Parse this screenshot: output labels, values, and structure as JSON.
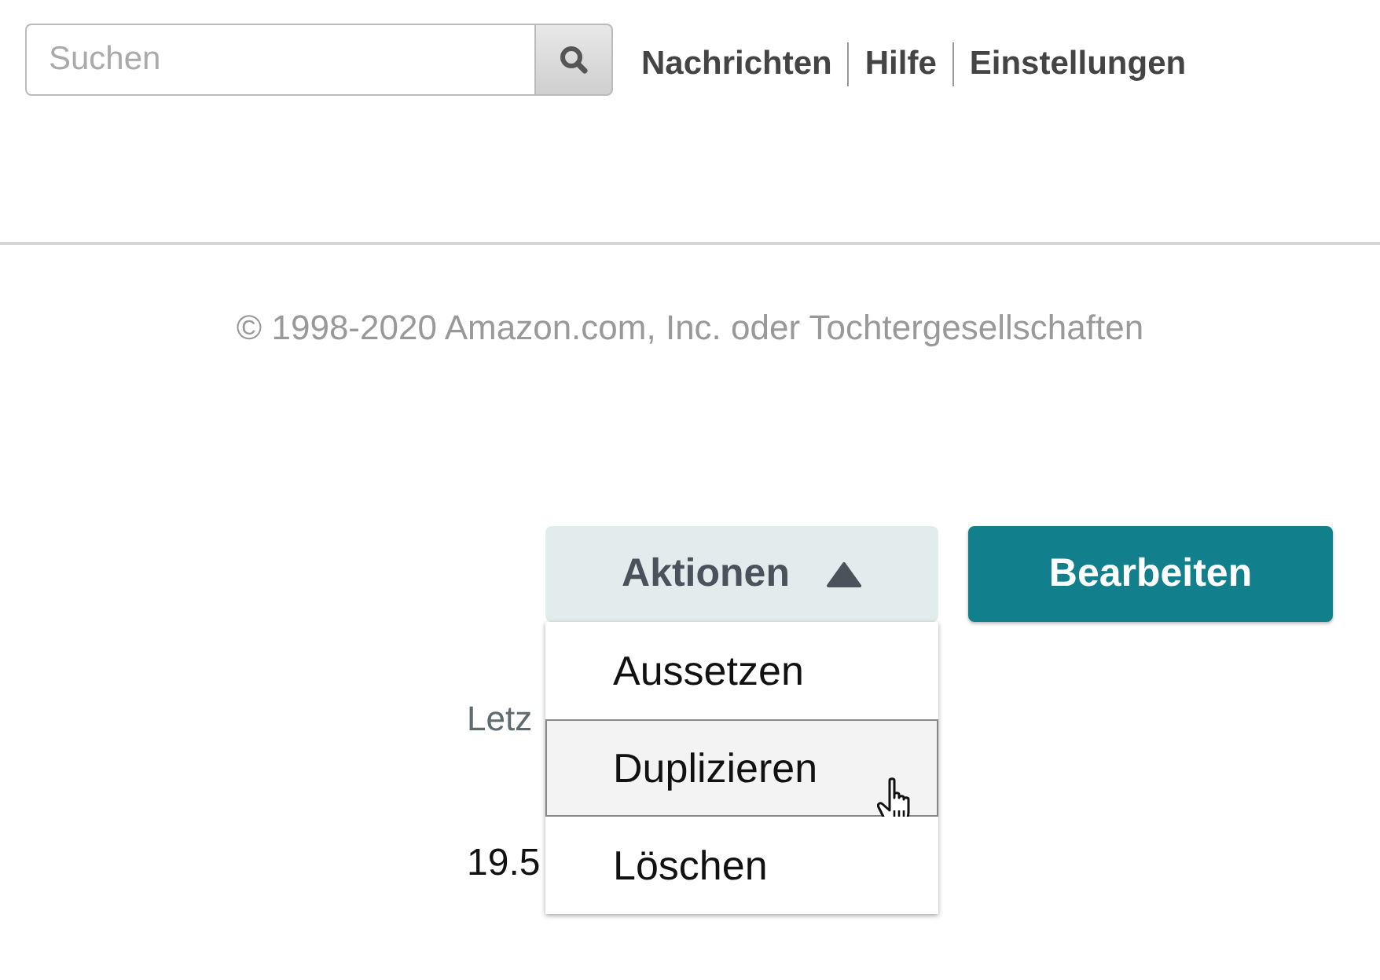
{
  "search": {
    "placeholder": "Suchen"
  },
  "nav_links": [
    "Nachrichten",
    "Hilfe",
    "Einstellungen"
  ],
  "footer": {
    "copyright": "© 1998-2020 Amazon.com, Inc. oder Tochtergesellschaften"
  },
  "actions": {
    "label": "Aktionen",
    "expanded": true,
    "items": [
      {
        "label": "Aussetzen",
        "selected": false
      },
      {
        "label": "Duplizieren",
        "selected": true
      },
      {
        "label": "Löschen",
        "selected": false
      }
    ]
  },
  "edit_button": "Bearbeiten",
  "details": {
    "label": "Letz",
    "value": "19.5"
  }
}
